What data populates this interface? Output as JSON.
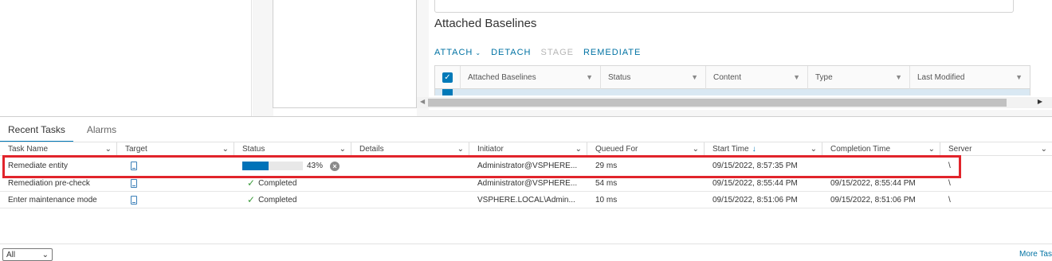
{
  "top": {
    "section_title": "Attached Baselines",
    "actions": [
      {
        "label": "ATTACH",
        "enabled": true,
        "has_dropdown": true
      },
      {
        "label": "DETACH",
        "enabled": true,
        "has_dropdown": false
      },
      {
        "label": "STAGE",
        "enabled": false,
        "has_dropdown": false
      },
      {
        "label": "REMEDIATE",
        "enabled": true,
        "has_dropdown": false
      }
    ],
    "baselines_columns": [
      "Attached Baselines",
      "Status",
      "Content",
      "Type",
      "Last Modified"
    ]
  },
  "tasks": {
    "tabs": [
      "Recent Tasks",
      "Alarms"
    ],
    "columns": [
      "Task Name",
      "Target",
      "Status",
      "Details",
      "Initiator",
      "Queued For",
      "Start Time",
      "Completion Time",
      "Server"
    ],
    "rows": [
      {
        "task_name": "Remediate entity",
        "progress_pct": 43,
        "progress_label": "43%",
        "status": "",
        "details": "",
        "initiator": "Administrator@VSPHERE...",
        "queued_for": "29 ms",
        "start_time": "09/15/2022, 8:57:35 PM",
        "completion_time": "",
        "server": "\\"
      },
      {
        "task_name": "Remediation pre-check",
        "progress_pct": null,
        "progress_label": "",
        "status": "Completed",
        "details": "",
        "initiator": "Administrator@VSPHERE...",
        "queued_for": "54 ms",
        "start_time": "09/15/2022, 8:55:44 PM",
        "completion_time": "09/15/2022, 8:55:44 PM",
        "server": "\\"
      },
      {
        "task_name": "Enter maintenance mode",
        "progress_pct": null,
        "progress_label": "",
        "status": "Completed",
        "details": "",
        "initiator": "VSPHERE.LOCAL\\Admin...",
        "queued_for": "10 ms",
        "start_time": "09/15/2022, 8:51:06 PM",
        "completion_time": "09/15/2022, 8:51:06 PM",
        "server": "\\"
      }
    ],
    "filter_value": "All",
    "more_tasks_label": "More Tas"
  },
  "colors": {
    "accent": "#0079b8",
    "highlight": "#e1242b",
    "success": "#3d9b3d"
  }
}
